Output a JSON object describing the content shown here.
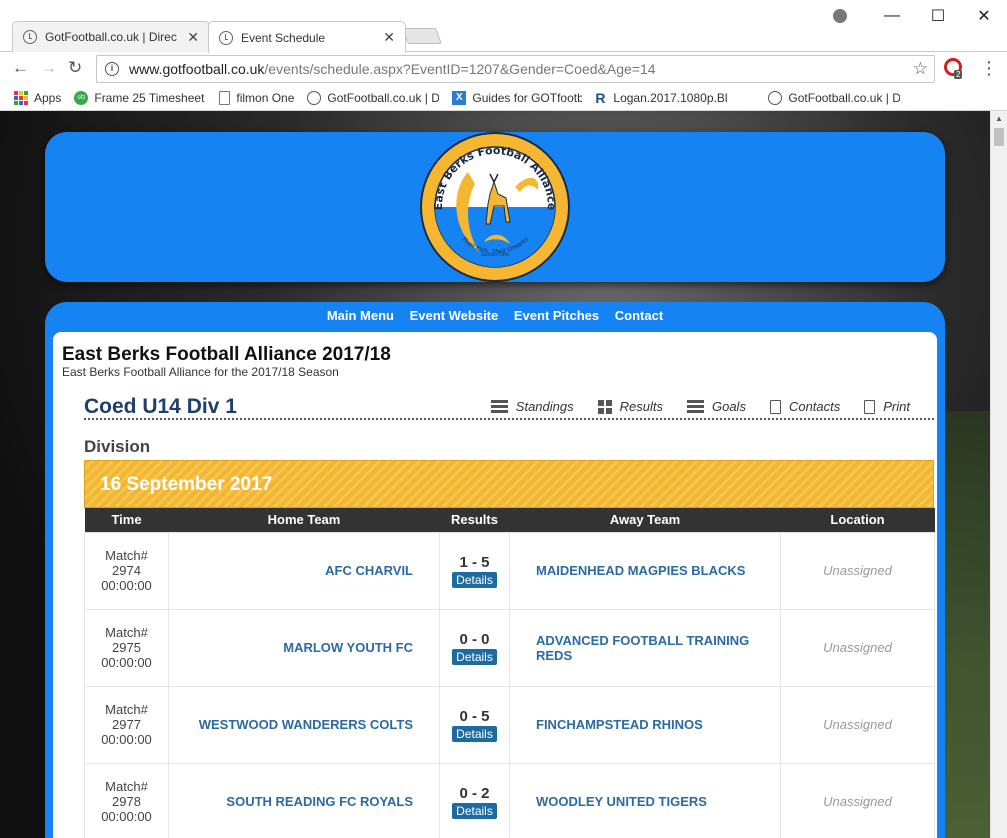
{
  "browser": {
    "tabs": [
      {
        "title": "GotFootball.co.uk | Direc",
        "active": false
      },
      {
        "title": "Event Schedule",
        "active": true
      }
    ],
    "url_host": "www.gotfootball.co.uk",
    "url_path": "/events/schedule.aspx?EventID=1207&Gender=Coed&Age=14",
    "ext_badge": "2",
    "bookmarks": [
      {
        "label": "Apps",
        "icon": "apps-grid-icon"
      },
      {
        "label": "Frame 25 Timesheet |",
        "icon": "ofz-icon"
      },
      {
        "label": "filmon One",
        "icon": "page-icon"
      },
      {
        "label": "GotFootball.co.uk | D",
        "icon": "clock-icon"
      },
      {
        "label": "Guides for GOTfootb",
        "icon": "x-icon"
      },
      {
        "label": "Logan.2017.1080p.Bl",
        "icon": "r-icon"
      },
      {
        "label": "GotFootball.co.uk | D",
        "icon": "clock-icon"
      }
    ]
  },
  "site": {
    "logo_text": "East Berks Football Alliance",
    "logo_tagline": "Their Kids, Their Dreams",
    "logo_founded": "Founded 1991",
    "nav": [
      "Main Menu",
      "Event Website",
      "Event Pitches",
      "Contact"
    ]
  },
  "event": {
    "title": "East Berks Football Alliance 2017/18",
    "subtitle": "East Berks Football Alliance for the 2017/18 Season"
  },
  "division": {
    "name": "Coed U14 Div 1",
    "links": [
      {
        "label": "Standings",
        "icon": "list-icon"
      },
      {
        "label": "Results",
        "icon": "grid-icon"
      },
      {
        "label": "Goals",
        "icon": "list-icon"
      },
      {
        "label": "Contacts",
        "icon": "document-icon"
      },
      {
        "label": "Print",
        "icon": "document-icon"
      }
    ],
    "section": "Division"
  },
  "schedule": {
    "date": "16 September 2017",
    "headers": [
      "Time",
      "Home Team",
      "Results",
      "Away Team",
      "Location"
    ],
    "details_label": "Details",
    "matches": [
      {
        "match_label": "Match#",
        "match_no": "2974",
        "time": "00:00:00",
        "home": "AFC CHARVIL",
        "score": "1 - 5",
        "away": "MAIDENHEAD MAGPIES BLACKS",
        "location": "Unassigned"
      },
      {
        "match_label": "Match#",
        "match_no": "2975",
        "time": "00:00:00",
        "home": "MARLOW YOUTH FC",
        "score": "0 - 0",
        "away": "ADVANCED FOOTBALL TRAINING REDS",
        "location": "Unassigned"
      },
      {
        "match_label": "Match#",
        "match_no": "2977",
        "time": "00:00:00",
        "home": "WESTWOOD WANDERERS COLTS",
        "score": "0 - 5",
        "away": "FINCHAMPSTEAD RHINOS",
        "location": "Unassigned"
      },
      {
        "match_label": "Match#",
        "match_no": "2978",
        "time": "00:00:00",
        "home": "SOUTH READING FC ROYALS",
        "score": "0 - 2",
        "away": "WOODLEY UNITED TIGERS",
        "location": "Unassigned"
      }
    ]
  },
  "colors": {
    "header_blue": "#1683f2",
    "date_bar_gold": "#f2b630",
    "team_link": "#2b6aa3",
    "details_button": "#1e6ba1"
  }
}
